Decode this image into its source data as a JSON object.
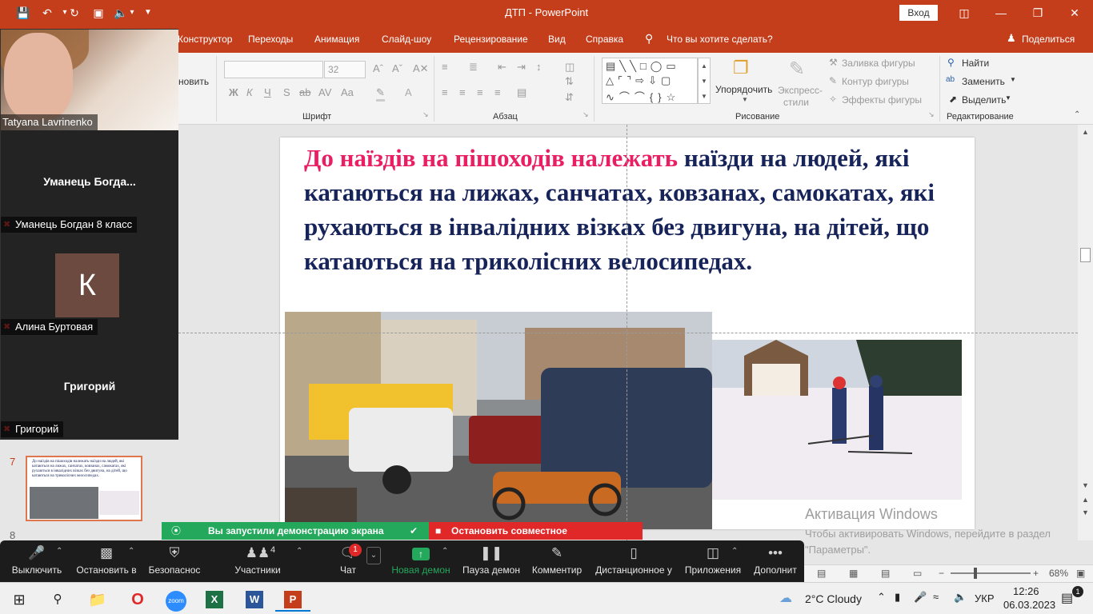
{
  "titlebar": {
    "title": "ДТП - PowerPoint",
    "signin_label": "Вход",
    "quick_access": [
      "save-icon",
      "undo-icon",
      "redo-icon",
      "present-icon",
      "volume-icon",
      "customize-icon"
    ]
  },
  "ribbon_tabs": [
    "Конструктор",
    "Переходы",
    "Анимация",
    "Слайд-шоу",
    "Рецензирование",
    "Вид",
    "Справка"
  ],
  "tell_me": "Что вы хотите сделать?",
  "share_label": "Поделиться",
  "ribbon": {
    "partial_label": "новить",
    "font_size": "32",
    "groups": {
      "font": "Шрифт",
      "paragraph": "Абзац",
      "drawing": "Рисование",
      "editing": "Редактирование"
    },
    "arrange_label": "Упорядочить",
    "express_styles_label_1": "Экспресс-",
    "express_styles_label_2": "стили",
    "shape_fill": "Заливка фигуры",
    "shape_outline": "Контур фигуры",
    "shape_effects": "Эффекты фигуры",
    "find": "Найти",
    "replace": "Заменить",
    "select": "Выделить",
    "font_buttons": [
      "Ж",
      "К",
      "Ч",
      "S",
      "ab",
      "AV",
      "Aa",
      "A"
    ]
  },
  "slide": {
    "pink_part_1": "До",
    "pink_part_2": "наїздів",
    "pink_part_3": "на",
    "pink_part_4": "пішоходів",
    "pink_part_5": "належать",
    "rest_text": "наїзди на людей, які катаються на лижах, санчатах, ковзанах, самокатах, які рухаються в інвалідних візках без двигуна, на дітей, що катаються на триколісних велосипедах."
  },
  "thumbnails": {
    "current_number": "7",
    "next_number": "8",
    "current_text": "До наїздів на пішоходів належать наїзди на людей, які катаються на лижах, санчатах, ковзанах, самокатах, які рухаються в інвалідних візках без двигуна, на дітей, що катаються на триколісних велосипедах."
  },
  "activation": {
    "line1": "Активация Windows",
    "line2": "Чтобы активировать Windows, перейдите в раздел \"Параметры\"."
  },
  "zoom_panel": {
    "participants": [
      {
        "name": "Tatyana Lavrinenko",
        "type": "video"
      },
      {
        "display": "Уманець  Богда...",
        "name": "Уманець Богдан 8 класс",
        "type": "name"
      },
      {
        "initial": "К",
        "name": "Алина Буртовая",
        "type": "avatar",
        "avatar_color": "#6d4a3f"
      },
      {
        "display": "Григорий",
        "name": "Григорий",
        "type": "name"
      }
    ]
  },
  "share_banner": {
    "sharing_text": "Вы запустили демонстрацию экрана",
    "stop_text": "Остановить совместное использование"
  },
  "zoom_toolbar": {
    "mute": "Выключить",
    "video": "Остановить в",
    "security": "Безопаснос",
    "participants": "Участники",
    "participants_count": "4",
    "chat": "Чат",
    "chat_badge": "1",
    "new_share": "Новая демон",
    "pause_share": "Пауза демон",
    "annotate": "Комментир",
    "remote_control": "Дистанционное у",
    "apps": "Приложения",
    "more": "Дополнит"
  },
  "statusbar": {
    "zoom_minus": "−",
    "zoom_plus": "+",
    "zoom_level": "68%"
  },
  "taskbar": {
    "apps": [
      "windows-start-icon",
      "search-icon",
      "file-explorer-icon",
      "opera-icon",
      "zoom-icon",
      "excel-icon",
      "word-icon",
      "powerpoint-icon"
    ],
    "zoom_app_label": "zoom",
    "weather": "2°C  Cloudy",
    "language": "УКР",
    "time": "12:26",
    "date": "06.03.2023",
    "notification_count": "1"
  },
  "colors": {
    "accent": "#c43e1c",
    "slide_text": "#17245a",
    "slide_highlight": "#e91e63",
    "share_green": "#23a85c",
    "stop_red": "#e02828"
  }
}
